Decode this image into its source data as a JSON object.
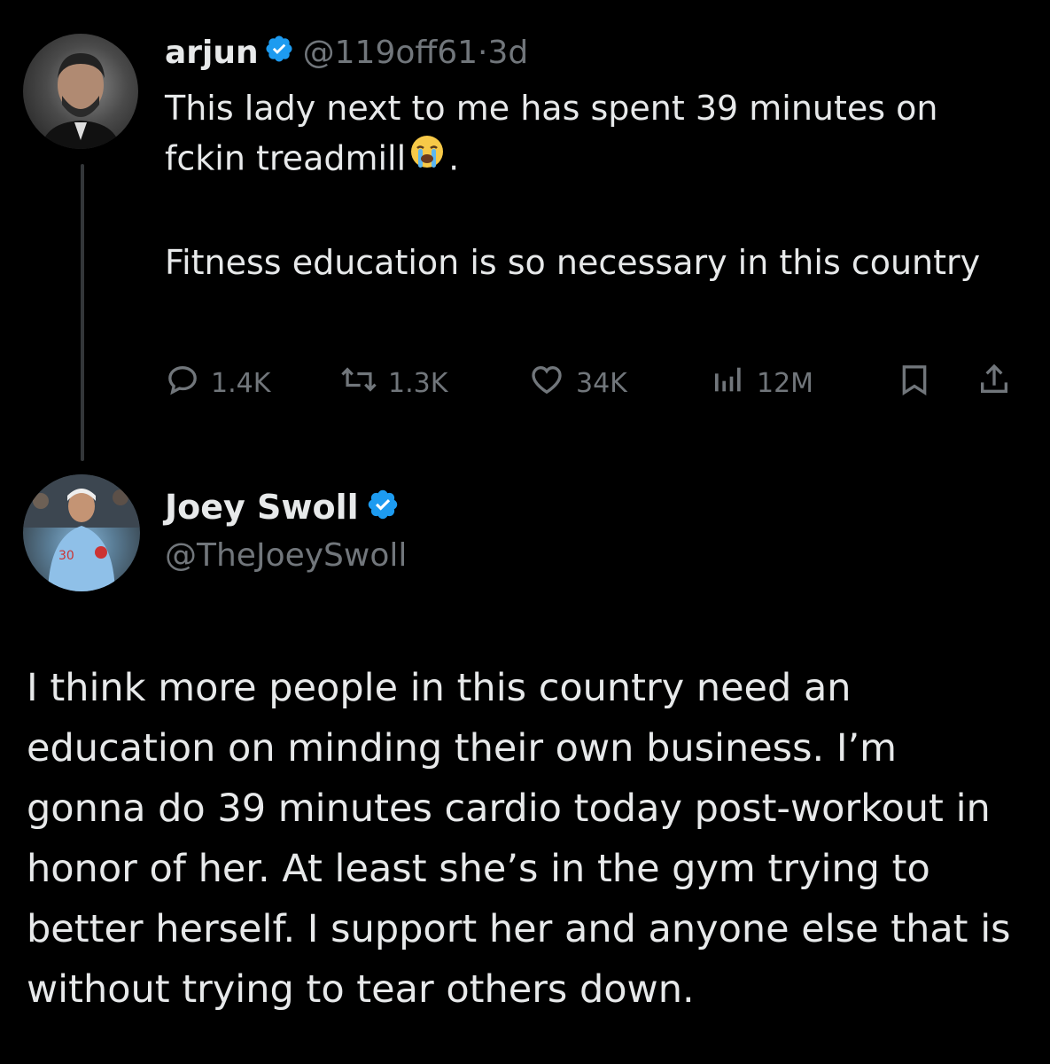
{
  "tweet1": {
    "name": "arjun",
    "handle": "@119off61",
    "separator": "·",
    "time": "3d",
    "text_line1": "This lady next to me has spent 39 minutes on fckin treadmill",
    "text_after_emoji": ".",
    "emoji": "loudly-crying-face",
    "text_para2": "Fitness education is so necessary in this country",
    "stats": {
      "replies": "1.4K",
      "reposts": "1.3K",
      "likes": "34K",
      "views": "12M"
    }
  },
  "tweet2": {
    "name": "Joey Swoll",
    "handle": "@TheJoeySwoll",
    "text": "I think more people in this country need an education on minding their own business. I’m gonna do 39 minutes cardio today post-workout in honor of her. At least she’s in the gym trying to better herself. I support her and anyone else that is without trying to tear others down."
  },
  "colors": {
    "background": "#000000",
    "text": "#e7e9ea",
    "muted": "#71767b",
    "verified": "#1d9bf0"
  }
}
